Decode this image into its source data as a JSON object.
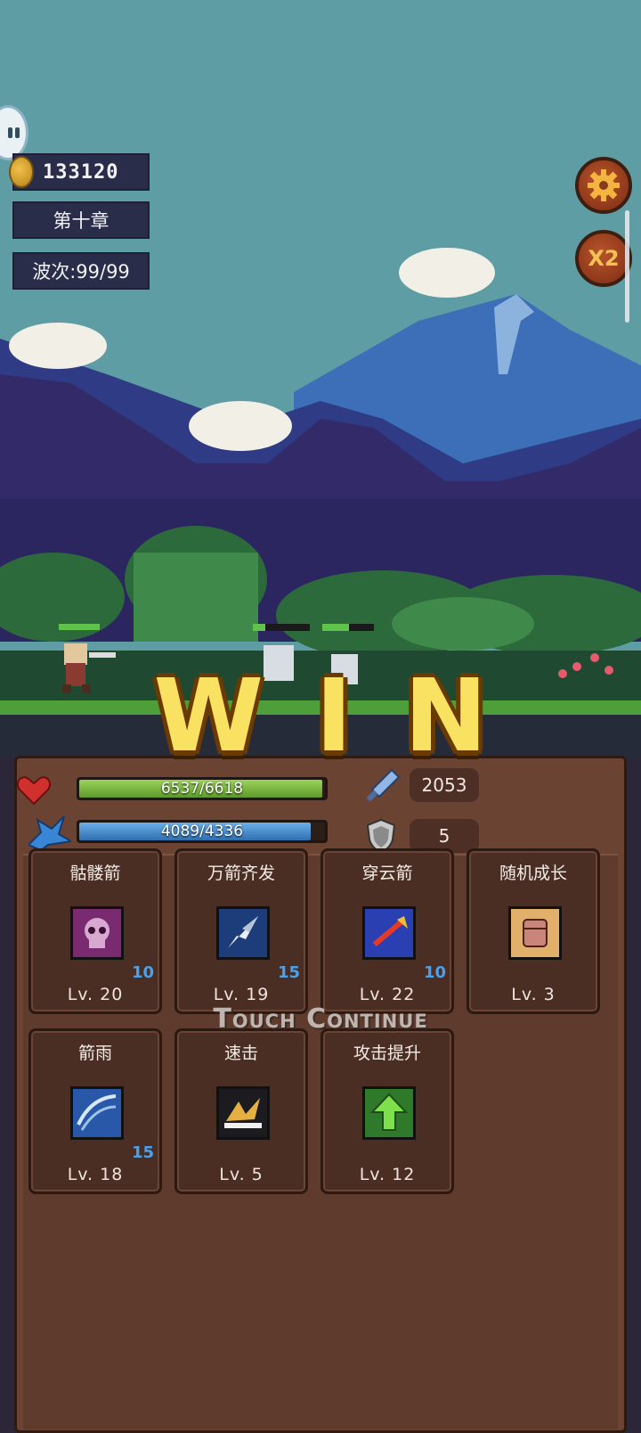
{
  "hud": {
    "coins": "133120",
    "chapter": "第十章",
    "wave": "波次:99/99"
  },
  "buttons": {
    "speed_label": "X2"
  },
  "result": {
    "win_letters": [
      "W",
      "I",
      "N"
    ],
    "touch_continue": "Touch Continue"
  },
  "stats": {
    "hp": "6537/6618",
    "hp_fraction": 0.988,
    "mp": "4089/4336",
    "mp_fraction": 0.943,
    "attack": "2053",
    "defense": "5"
  },
  "skills": [
    {
      "name": "骷髅箭",
      "level": "Lv. 20",
      "count": "10",
      "icon": "skull-icon"
    },
    {
      "name": "万箭齐发",
      "level": "Lv. 19",
      "count": "15",
      "icon": "arrow-volley-icon"
    },
    {
      "name": "穿云箭",
      "level": "Lv. 22",
      "count": "10",
      "icon": "piercing-arrow-icon"
    },
    {
      "name": "随机成长",
      "level": "Lv. 3",
      "count": "",
      "icon": "fist-icon"
    },
    {
      "name": "箭雨",
      "level": "Lv. 18",
      "count": "15",
      "icon": "arrow-rain-icon"
    },
    {
      "name": "速击",
      "level": "Lv. 5",
      "count": "",
      "icon": "swift-strike-icon"
    },
    {
      "name": "攻击提升",
      "level": "Lv. 12",
      "count": "",
      "icon": "attack-up-icon"
    }
  ]
}
